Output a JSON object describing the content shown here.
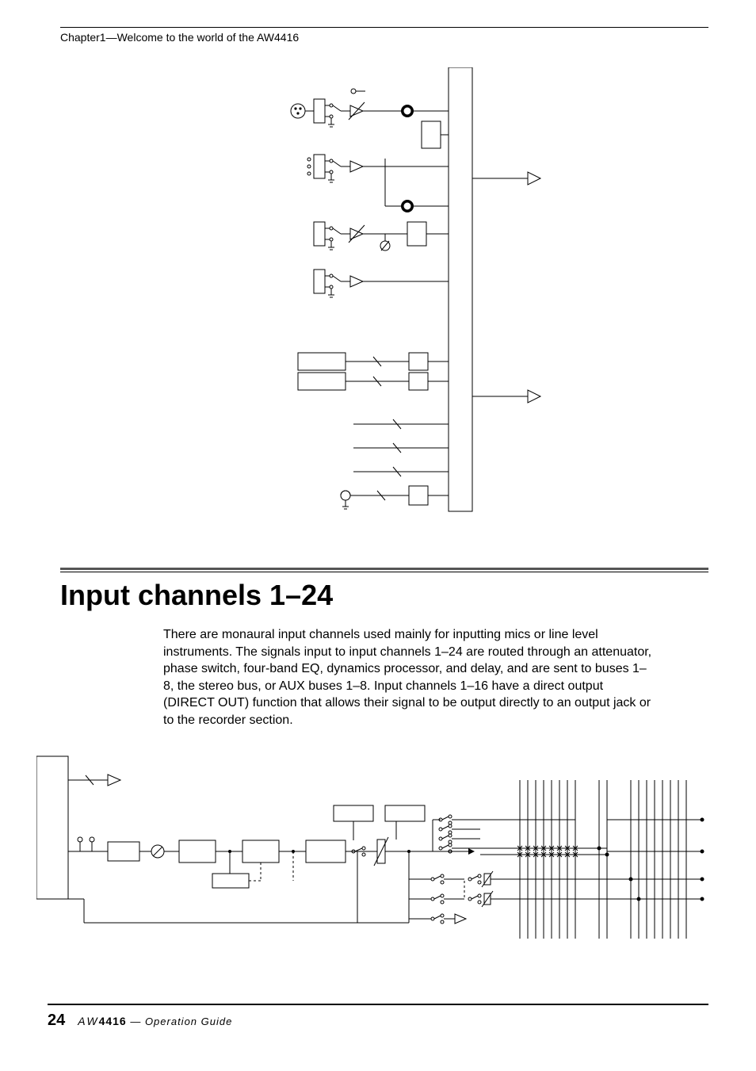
{
  "header": {
    "chapter": "Chapter1—Welcome to the world of the AW4416"
  },
  "section": {
    "title": "Input channels 1–24",
    "body": "There are monaural input channels used mainly for inputting mics or line level instruments. The signals input to input channels 1–24 are routed through an attenuator, phase switch, four-band EQ, dynamics processor, and delay, and are sent to buses 1–8, the stereo bus, or AUX buses 1–8. Input channels 1–16 have a direct output (DIRECT OUT) function that allows their signal to be output directly to an output jack or to the recorder section."
  },
  "footer": {
    "page": "24",
    "product_prefix": "AW",
    "product_model": "4416",
    "guide": " — Operation Guide"
  }
}
